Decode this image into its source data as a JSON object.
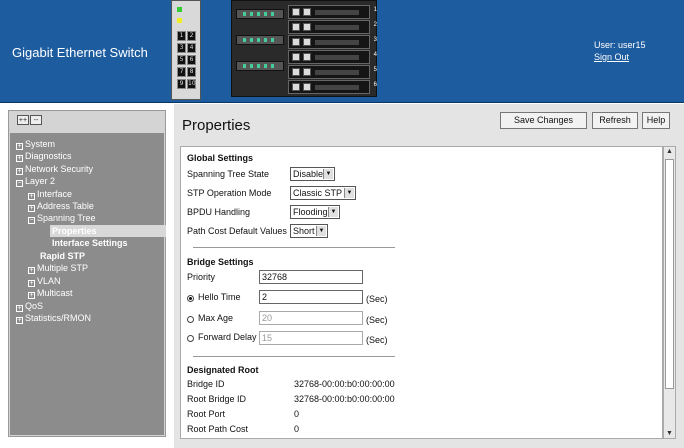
{
  "header": {
    "brand": "Gigabit Ethernet Switch",
    "user_text": "User: user15",
    "sign_out": "Sign Out",
    "device_ports": [
      "1",
      "2",
      "3",
      "4",
      "5",
      "6",
      "7",
      "8",
      "9",
      "10"
    ],
    "bay_numbers": [
      "1",
      "2",
      "3",
      "4",
      "5",
      "6"
    ],
    "bg_color": "#1e5ca0"
  },
  "nav": {
    "expand_all": "++",
    "collapse_all": "--",
    "items": [
      {
        "label": "System",
        "pm": "+"
      },
      {
        "label": "Diagnostics",
        "pm": "+"
      },
      {
        "label": "Network Security",
        "pm": "+"
      },
      {
        "label": "Layer 2",
        "pm": "−"
      },
      {
        "label": "Interface",
        "pm": "+"
      },
      {
        "label": "Address Table",
        "pm": "+"
      },
      {
        "label": "Spanning Tree",
        "pm": "−"
      },
      {
        "label": "Properties",
        "pm": ""
      },
      {
        "label": "Interface Settings",
        "pm": ""
      },
      {
        "label": "Rapid STP",
        "pm": ""
      },
      {
        "label": "Multiple STP",
        "pm": "+"
      },
      {
        "label": "VLAN",
        "pm": "+"
      },
      {
        "label": "Multicast",
        "pm": "+"
      },
      {
        "label": "QoS",
        "pm": "+"
      },
      {
        "label": "Statistics/RMON",
        "pm": "+"
      }
    ]
  },
  "page": {
    "title": "Properties",
    "buttons": {
      "save": "Save Changes",
      "refresh": "Refresh",
      "help": "Help"
    }
  },
  "global": {
    "heading": "Global Settings",
    "stp_state_label": "Spanning Tree State",
    "stp_state_value": "Disable",
    "stp_mode_label": "STP Operation Mode",
    "stp_mode_value": "Classic STP",
    "bpdu_label": "BPDU Handling",
    "bpdu_value": "Flooding",
    "pathcost_label": "Path Cost Default Values",
    "pathcost_value": "Short"
  },
  "bridge": {
    "heading": "Bridge Settings",
    "priority_label": "Priority",
    "priority_value": "32768",
    "hello_label": "Hello Time",
    "hello_value": "2",
    "maxage_label": "Max Age",
    "maxage_value": "20",
    "fwd_label": "Forward Delay",
    "fwd_value": "15",
    "unit": "(Sec)"
  },
  "root": {
    "heading": "Designated Root",
    "bridge_id_label": "Bridge ID",
    "bridge_id_value": "32768-00:00:b0:00:00:00",
    "root_bridge_id_label": "Root Bridge ID",
    "root_bridge_id_value": "32768-00:00:b0:00:00:00",
    "root_port_label": "Root Port",
    "root_port_value": "0",
    "root_path_cost_label": "Root Path Cost",
    "root_path_cost_value": "0"
  }
}
